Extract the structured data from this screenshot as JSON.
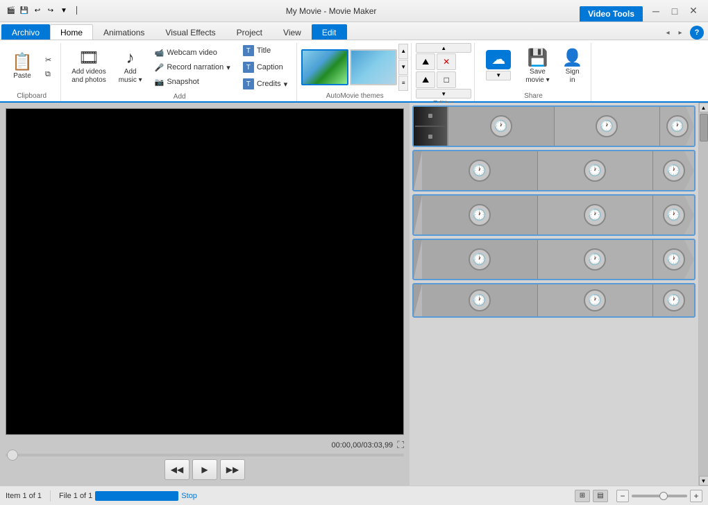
{
  "titlebar": {
    "title": "My Movie - Movie Maker",
    "video_tools_label": "Video Tools",
    "min_btn": "─",
    "max_btn": "□",
    "close_btn": "✕"
  },
  "tabs": [
    {
      "id": "archivo",
      "label": "Archivo",
      "active": false,
      "style": "archivo"
    },
    {
      "id": "home",
      "label": "Home",
      "active": true
    },
    {
      "id": "animations",
      "label": "Animations"
    },
    {
      "id": "visual_effects",
      "label": "Visual Effects"
    },
    {
      "id": "project",
      "label": "Project"
    },
    {
      "id": "view",
      "label": "View"
    },
    {
      "id": "edit",
      "label": "Edit",
      "style": "edit-tab"
    }
  ],
  "ribbon": {
    "groups": {
      "clipboard": {
        "label": "Clipboard",
        "paste_label": "Paste"
      },
      "add": {
        "label": "Add",
        "add_videos_label": "Add videos\nand photos",
        "add_music_label": "Add\nmusic",
        "webcam_label": "Webcam video",
        "narration_label": "Record narration",
        "snapshot_label": "Snapshot",
        "title_label": "Title",
        "caption_label": "Caption",
        "credits_label": "Credits"
      },
      "themes": {
        "label": "AutoMovie themes"
      },
      "editing": {
        "label": "Editing"
      },
      "share": {
        "label": "Share",
        "save_movie_label": "Save\nmovie",
        "sign_in_label": "Sign\nin"
      }
    }
  },
  "preview": {
    "time_display": "00:00,00/03:03,99"
  },
  "playback": {
    "prev_btn": "◀◀",
    "play_btn": "▶",
    "next_btn": "▶▶"
  },
  "status": {
    "item_label": "Item 1 of 1",
    "file_label": "File 1 of 1",
    "stop_label": "Stop"
  },
  "icons": {
    "paste": "📋",
    "cut": "✂",
    "copy": "⧉",
    "undo": "↩",
    "redo": "↪",
    "film": "🎞",
    "music": "♪",
    "webcam": "📹",
    "microphone": "🎤",
    "camera": "📷",
    "title_t": "T",
    "caption_t": "T",
    "credits_t": "T",
    "cloud": "☁",
    "save": "💾",
    "person": "👤",
    "scissors_red": "✂",
    "help": "?"
  }
}
